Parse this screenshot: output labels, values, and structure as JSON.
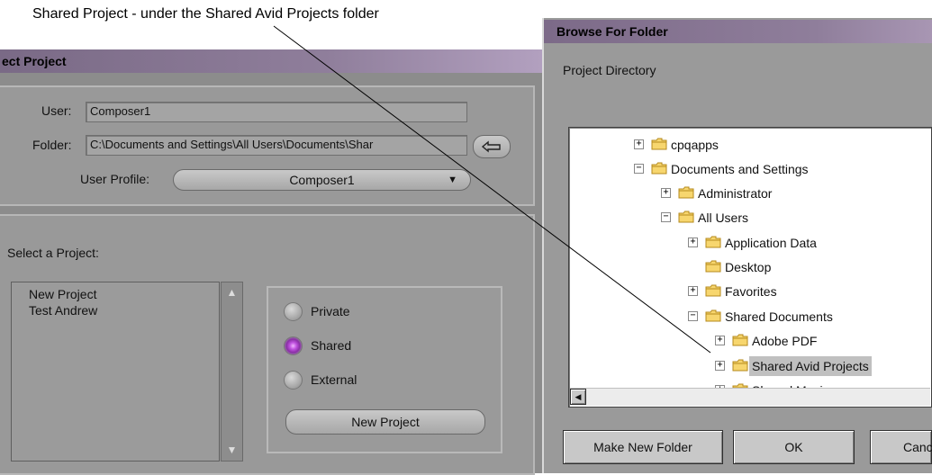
{
  "annotation": {
    "text": "Shared Project - under the Shared Avid Projects folder"
  },
  "select_project": {
    "title": "ect Project",
    "user_label": "User:",
    "user_value": "Composer1",
    "folder_label": "Folder:",
    "folder_value": "C:\\Documents and Settings\\All Users\\Documents\\Shar",
    "user_profile_label": "User Profile:",
    "user_profile_value": "Composer1",
    "select_label": "Select a Project:",
    "projects": [
      "New Project",
      "Test Andrew"
    ],
    "radio_private": "Private",
    "radio_shared": "Shared",
    "radio_external": "External",
    "selected_radio": "Shared",
    "new_project_button": "New Project"
  },
  "browse_dialog": {
    "title": "Browse For Folder",
    "instruction": "Project Directory",
    "tree": [
      {
        "label": "cpqapps",
        "expander": "+"
      },
      {
        "label": "Documents and Settings",
        "expander": "-"
      },
      {
        "label": "Administrator",
        "expander": "+"
      },
      {
        "label": "All Users",
        "expander": "-"
      },
      {
        "label": "Application Data",
        "expander": "+"
      },
      {
        "label": "Desktop",
        "expander": ""
      },
      {
        "label": "Favorites",
        "expander": "+"
      },
      {
        "label": "Shared Documents",
        "expander": "-"
      },
      {
        "label": "Adobe PDF",
        "expander": "+"
      },
      {
        "label": "Shared Avid Projects",
        "expander": "+",
        "selected": true
      },
      {
        "label": "Shared Music",
        "expander": "+"
      }
    ],
    "make_new_folder_button": "Make New Folder",
    "ok_button": "OK",
    "cancel_button": "Canc"
  },
  "colors": {
    "title_bar": "#8f7e9b",
    "selected_radio": "#c052e0",
    "tree_selection": "#c0c0c0"
  }
}
